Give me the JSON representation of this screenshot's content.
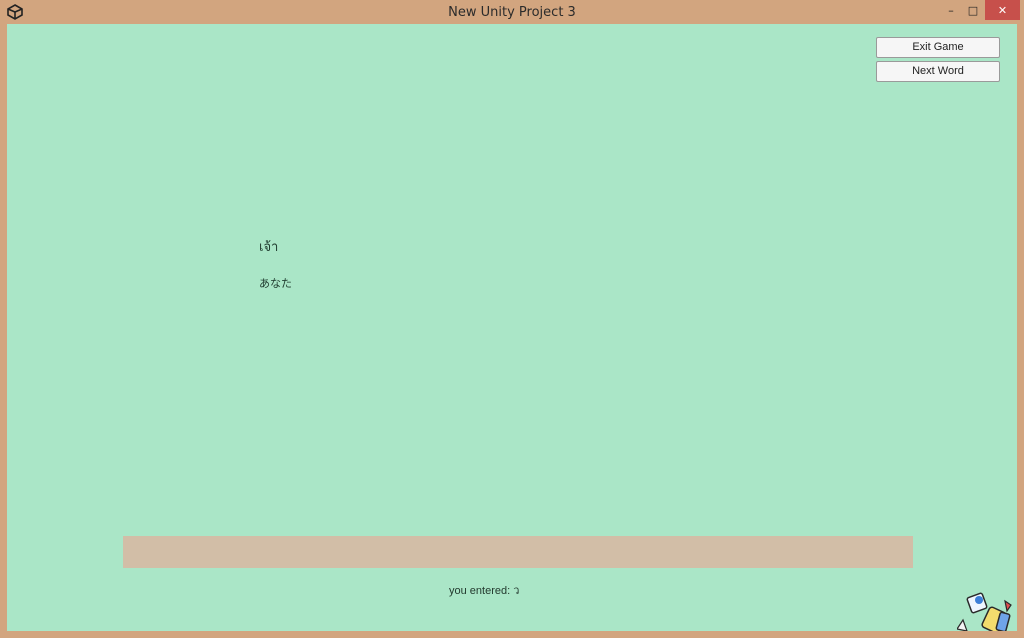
{
  "window": {
    "title": "New Unity Project 3",
    "controls": {
      "minimize": "–",
      "maximize": "□",
      "close": "✕"
    },
    "colors": {
      "frame": "#d2a57f",
      "background": "#aae6c7",
      "input_bar": "#d2bea7",
      "close_button": "#c7504b"
    }
  },
  "game": {
    "buttons": {
      "exit": "Exit Game",
      "next": "Next Word"
    },
    "word": "เจ้า",
    "translation": "あなた",
    "entered": "you entered: ว"
  }
}
